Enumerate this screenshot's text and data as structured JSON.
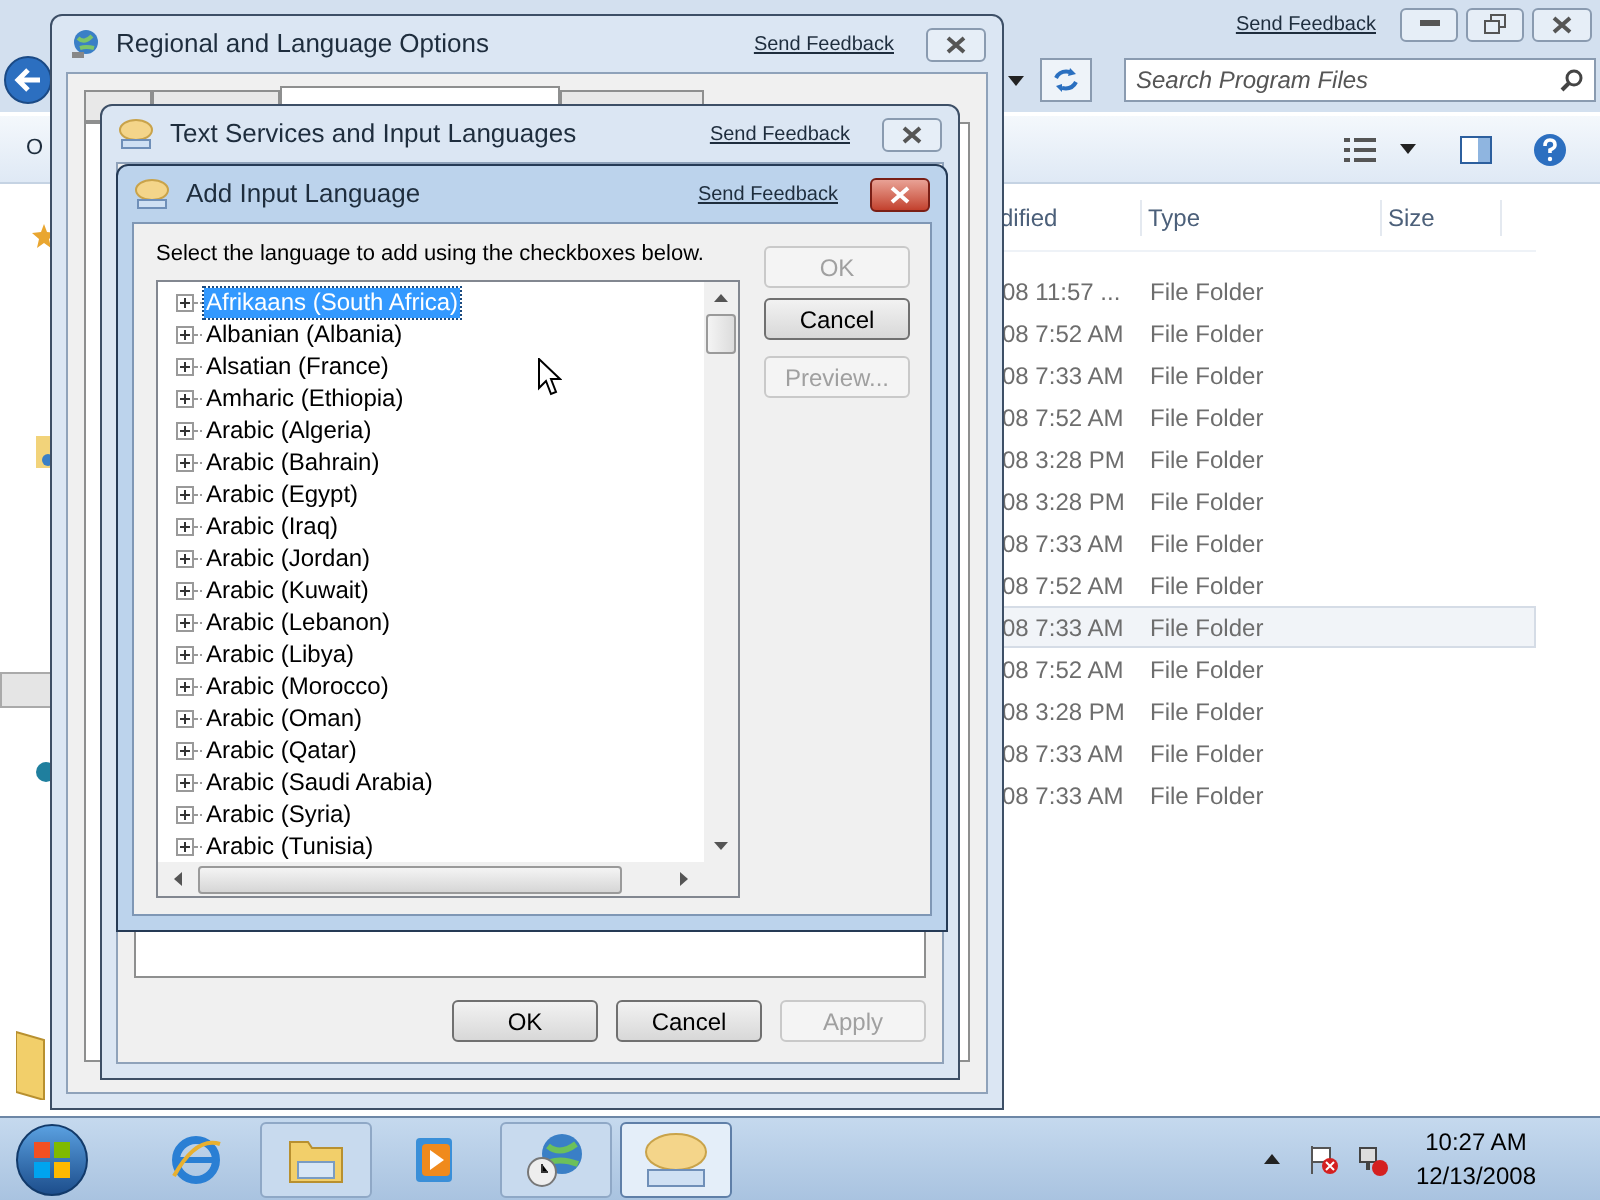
{
  "explorer": {
    "feedback": "Send Feedback",
    "search": {
      "placeholder": "Search Program Files"
    },
    "command_text": "O",
    "columns": [
      "dified",
      "Type",
      "Size"
    ],
    "rows": [
      {
        "modified": "08 11:57 ...",
        "type": "File Folder",
        "selected": false
      },
      {
        "modified": "08 7:52 AM",
        "type": "File Folder",
        "selected": false
      },
      {
        "modified": "08 7:33 AM",
        "type": "File Folder",
        "selected": false
      },
      {
        "modified": "08 7:52 AM",
        "type": "File Folder",
        "selected": false
      },
      {
        "modified": "08 3:28 PM",
        "type": "File Folder",
        "selected": false
      },
      {
        "modified": "08 3:28 PM",
        "type": "File Folder",
        "selected": false
      },
      {
        "modified": "08 7:33 AM",
        "type": "File Folder",
        "selected": false
      },
      {
        "modified": "08 7:52 AM",
        "type": "File Folder",
        "selected": false
      },
      {
        "modified": "08 7:33 AM",
        "type": "File Folder",
        "selected": true
      },
      {
        "modified": "08 7:52 AM",
        "type": "File Folder",
        "selected": false
      },
      {
        "modified": "08 3:28 PM",
        "type": "File Folder",
        "selected": false
      },
      {
        "modified": "08 7:33 AM",
        "type": "File Folder",
        "selected": false
      },
      {
        "modified": "08 7:33 AM",
        "type": "File Folder",
        "selected": false
      }
    ]
  },
  "regional_dialog": {
    "title": "Regional and Language Options",
    "feedback": "Send Feedback",
    "tabs": [
      {
        "selected": false
      },
      {
        "selected": false
      },
      {
        "selected": true
      },
      {
        "selected": false
      }
    ]
  },
  "text_services_dialog": {
    "title": "Text Services and Input Languages",
    "feedback": "Send Feedback",
    "buttons": [
      {
        "label": "OK",
        "disabled": false
      },
      {
        "label": "Cancel",
        "disabled": false
      },
      {
        "label": "Apply",
        "disabled": true
      }
    ]
  },
  "add_language_dialog": {
    "title": "Add Input Language",
    "feedback": "Send Feedback",
    "instruction": "Select the language to add using the checkboxes below.",
    "languages": [
      {
        "label": "Afrikaans (South Africa)",
        "selected": true
      },
      {
        "label": "Albanian (Albania)",
        "selected": false
      },
      {
        "label": "Alsatian (France)",
        "selected": false
      },
      {
        "label": "Amharic (Ethiopia)",
        "selected": false
      },
      {
        "label": "Arabic (Algeria)",
        "selected": false
      },
      {
        "label": "Arabic (Bahrain)",
        "selected": false
      },
      {
        "label": "Arabic (Egypt)",
        "selected": false
      },
      {
        "label": "Arabic (Iraq)",
        "selected": false
      },
      {
        "label": "Arabic (Jordan)",
        "selected": false
      },
      {
        "label": "Arabic (Kuwait)",
        "selected": false
      },
      {
        "label": "Arabic (Lebanon)",
        "selected": false
      },
      {
        "label": "Arabic (Libya)",
        "selected": false
      },
      {
        "label": "Arabic (Morocco)",
        "selected": false
      },
      {
        "label": "Arabic (Oman)",
        "selected": false
      },
      {
        "label": "Arabic (Qatar)",
        "selected": false
      },
      {
        "label": "Arabic (Saudi Arabia)",
        "selected": false
      },
      {
        "label": "Arabic (Syria)",
        "selected": false
      },
      {
        "label": "Arabic (Tunisia)",
        "selected": false
      }
    ],
    "buttons": [
      {
        "label": "OK",
        "disabled": true
      },
      {
        "label": "Cancel",
        "disabled": false
      },
      {
        "label": "Preview...",
        "disabled": true
      }
    ]
  },
  "taskbar": {
    "apps": [
      {
        "kind": "browser",
        "running": false,
        "selected": false
      },
      {
        "kind": "explorer",
        "running": true,
        "selected": false
      },
      {
        "kind": "media",
        "running": false,
        "selected": false
      },
      {
        "kind": "globe",
        "running": true,
        "selected": false
      },
      {
        "kind": "keyboard",
        "running": true,
        "selected": true
      }
    ],
    "clock": {
      "time": "10:27 AM",
      "date": "12/13/2008"
    }
  }
}
